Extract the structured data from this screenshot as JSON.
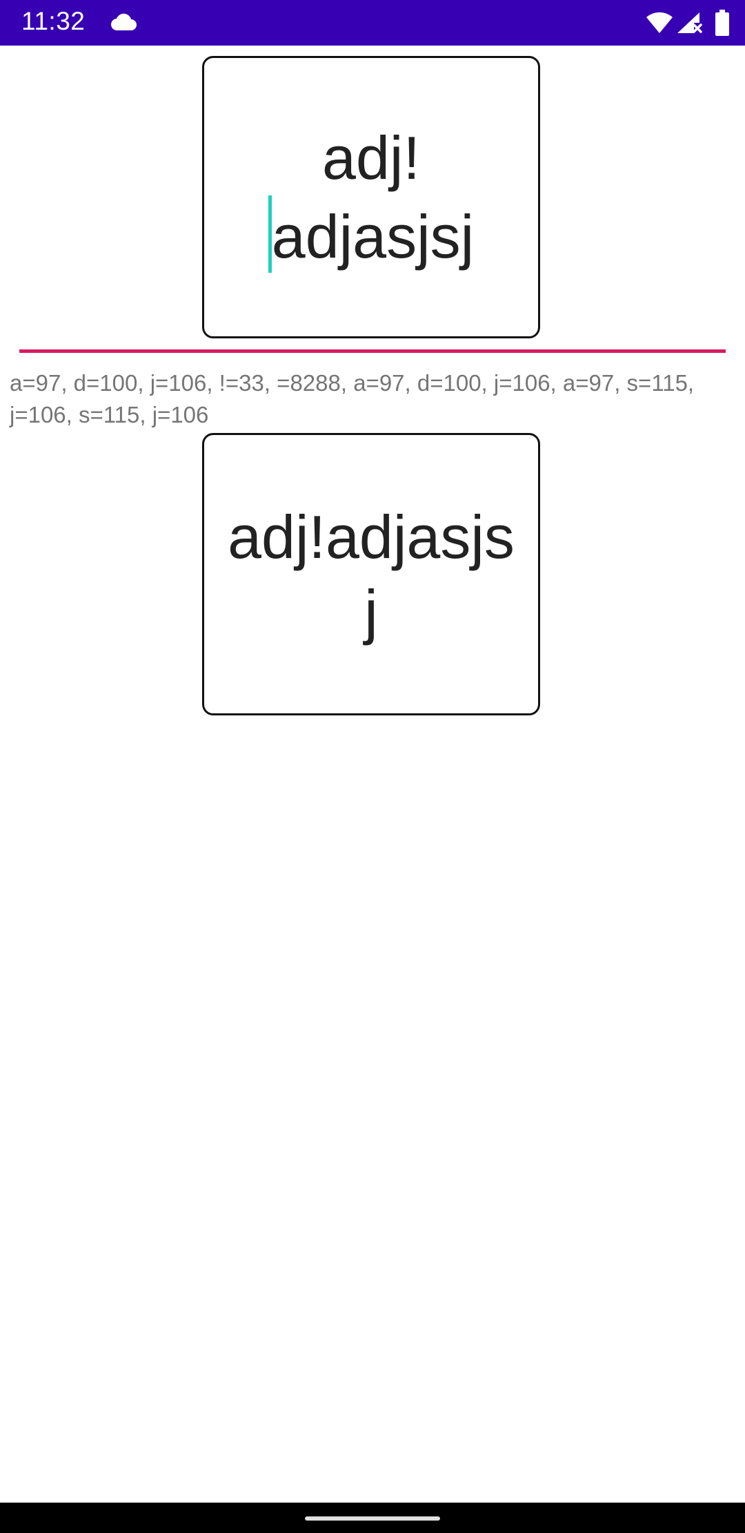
{
  "status_bar": {
    "time": "11:32",
    "background": "#3700b3",
    "icons": [
      "cloud-icon",
      "wifi-icon",
      "cell-signal-no-data-icon",
      "battery-icon"
    ]
  },
  "input_box": {
    "line1": "adj!",
    "line2": "adjasjsj",
    "caret_color": "#1fcfc0",
    "underline_color": "#d81b60"
  },
  "char_codes": "a=97, d=100, j=106, !=33, =8288, a=97, d=100, j=106, a=97, s=115, j=106, s=115, j=106",
  "output_box": {
    "text": "adj!adjasjsj"
  }
}
